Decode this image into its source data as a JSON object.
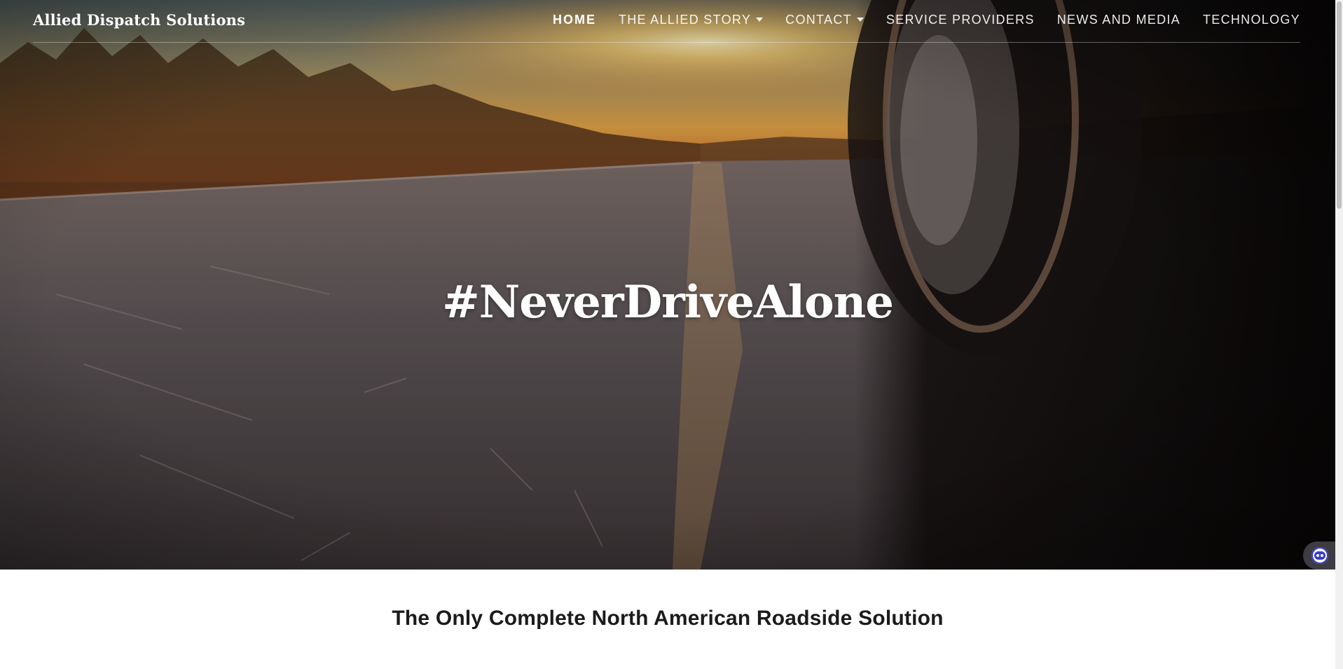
{
  "header": {
    "logo": "Allied Dispatch Solutions",
    "nav": [
      {
        "label": "HOME",
        "active": true,
        "has_dropdown": false
      },
      {
        "label": "THE ALLIED STORY",
        "active": false,
        "has_dropdown": true
      },
      {
        "label": "CONTACT",
        "active": false,
        "has_dropdown": true
      },
      {
        "label": "SERVICE PROVIDERS",
        "active": false,
        "has_dropdown": false
      },
      {
        "label": "NEWS AND MEDIA",
        "active": false,
        "has_dropdown": false
      },
      {
        "label": "TECHNOLOGY",
        "active": false,
        "has_dropdown": false
      }
    ]
  },
  "hero": {
    "title": "#NeverDriveAlone",
    "background_image": "road-sunset-tire-photo"
  },
  "main": {
    "tagline": "The Only Complete North American Roadside Solution"
  },
  "chat_widget": {
    "icon": "chat-bot-icon"
  },
  "colors": {
    "text_light": "#ffffff",
    "text_dark": "#1b1b1b",
    "chat_accent": "#3b3cc9"
  }
}
